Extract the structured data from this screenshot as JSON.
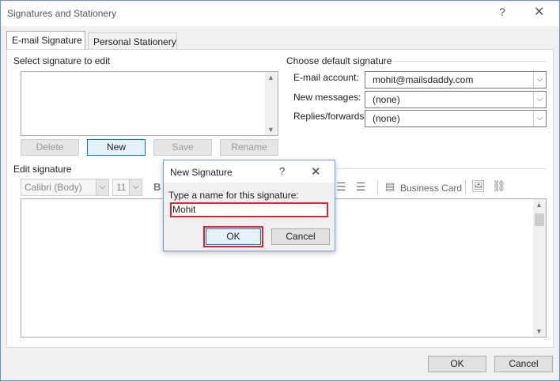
{
  "window": {
    "title": "Signatures and Stationery",
    "help": "?",
    "close": "✕"
  },
  "tabs": [
    {
      "label": "E-mail Signature",
      "accel": "E"
    },
    {
      "label": "Personal Stationery",
      "accel": "P"
    }
  ],
  "select_section": {
    "label": "Select signature to edit",
    "buttons": {
      "delete": "Delete",
      "new": "New",
      "save": "Save",
      "rename": "Rename"
    }
  },
  "default_section": {
    "label": "Choose default signature",
    "email_account_label": "E-mail account:",
    "email_account_value": "mohit@mailsdaddy.com",
    "new_messages_label": "New messages:",
    "new_messages_value": "(none)",
    "replies_label": "Replies/forwards:",
    "replies_value": "(none)"
  },
  "edit_section": {
    "label": "Edit signature",
    "font_value": "Calibri (Body)",
    "size_value": "11",
    "bold": "B",
    "business_card": "Business Card"
  },
  "dialog": {
    "title": "New Signature",
    "help": "?",
    "close": "✕",
    "prompt": "Type a name for this signature:",
    "input_value": "Mohit",
    "ok": "OK",
    "cancel": "Cancel"
  },
  "footer": {
    "ok": "OK",
    "cancel": "Cancel"
  },
  "colors": {
    "highlight": "#d9232e",
    "window_border": "#6c8ebf"
  }
}
